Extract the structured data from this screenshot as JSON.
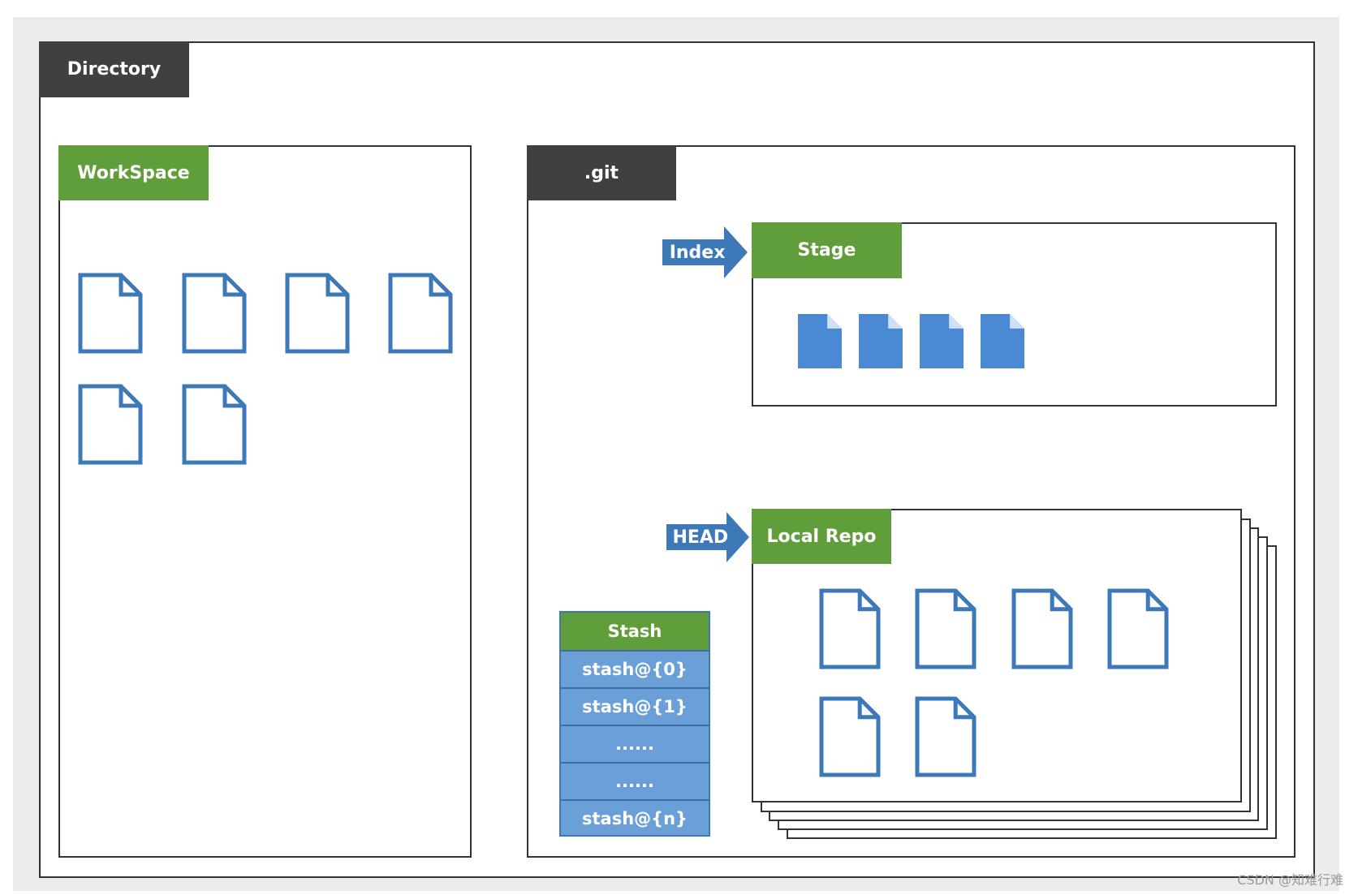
{
  "labels": {
    "directory": "Directory",
    "workspace": "WorkSpace",
    "git": ".git",
    "stage": "Stage",
    "index": "Index",
    "local_repo": "Local Repo",
    "head": "HEAD"
  },
  "stash": {
    "title": "Stash",
    "items": [
      "stash@{0}",
      "stash@{1}",
      "......",
      "......",
      "stash@{n}"
    ]
  },
  "watermark": "CSDN @知难行难",
  "colors": {
    "green": "#5f9e3a",
    "dark": "#404040",
    "blue": "#3d78b8",
    "file_fill": "#4a8ad4"
  },
  "counts": {
    "workspace_files": 6,
    "stage_files": 4,
    "local_repo_files": 6
  }
}
